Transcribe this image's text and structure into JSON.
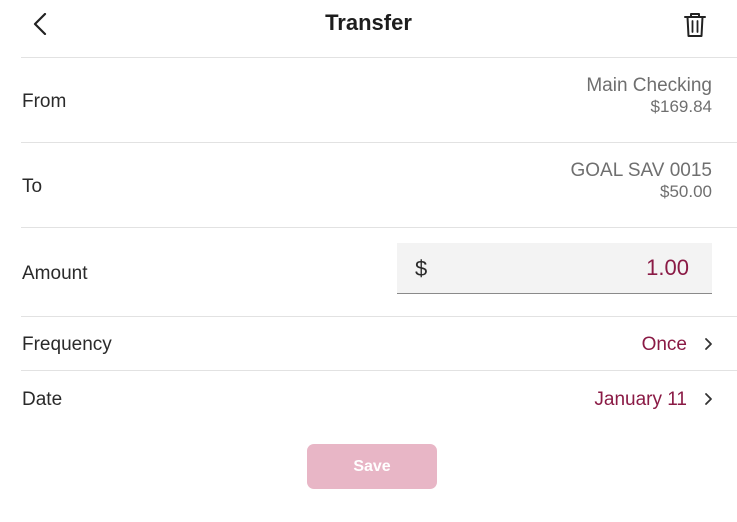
{
  "header": {
    "title": "Transfer",
    "back_icon": "chevron-left-icon",
    "delete_icon": "trash-icon"
  },
  "from": {
    "label": "From",
    "account_name": "Main Checking",
    "balance": "$169.84"
  },
  "to": {
    "label": "To",
    "account_name": "GOAL SAV 0015",
    "balance": "$50.00"
  },
  "amount": {
    "label": "Amount",
    "currency_symbol": "$",
    "value": "1.00"
  },
  "frequency": {
    "label": "Frequency",
    "value": "Once",
    "icon": "chevron-right-icon"
  },
  "date": {
    "label": "Date",
    "value": "January 11",
    "icon": "chevron-right-icon"
  },
  "save": {
    "label": "Save",
    "state": "disabled"
  },
  "colors": {
    "accent": "#8a1a45",
    "save_button_background": "#e8b6c6",
    "secondary_text": "#6f6f6f",
    "divider": "#e2e2e2"
  }
}
